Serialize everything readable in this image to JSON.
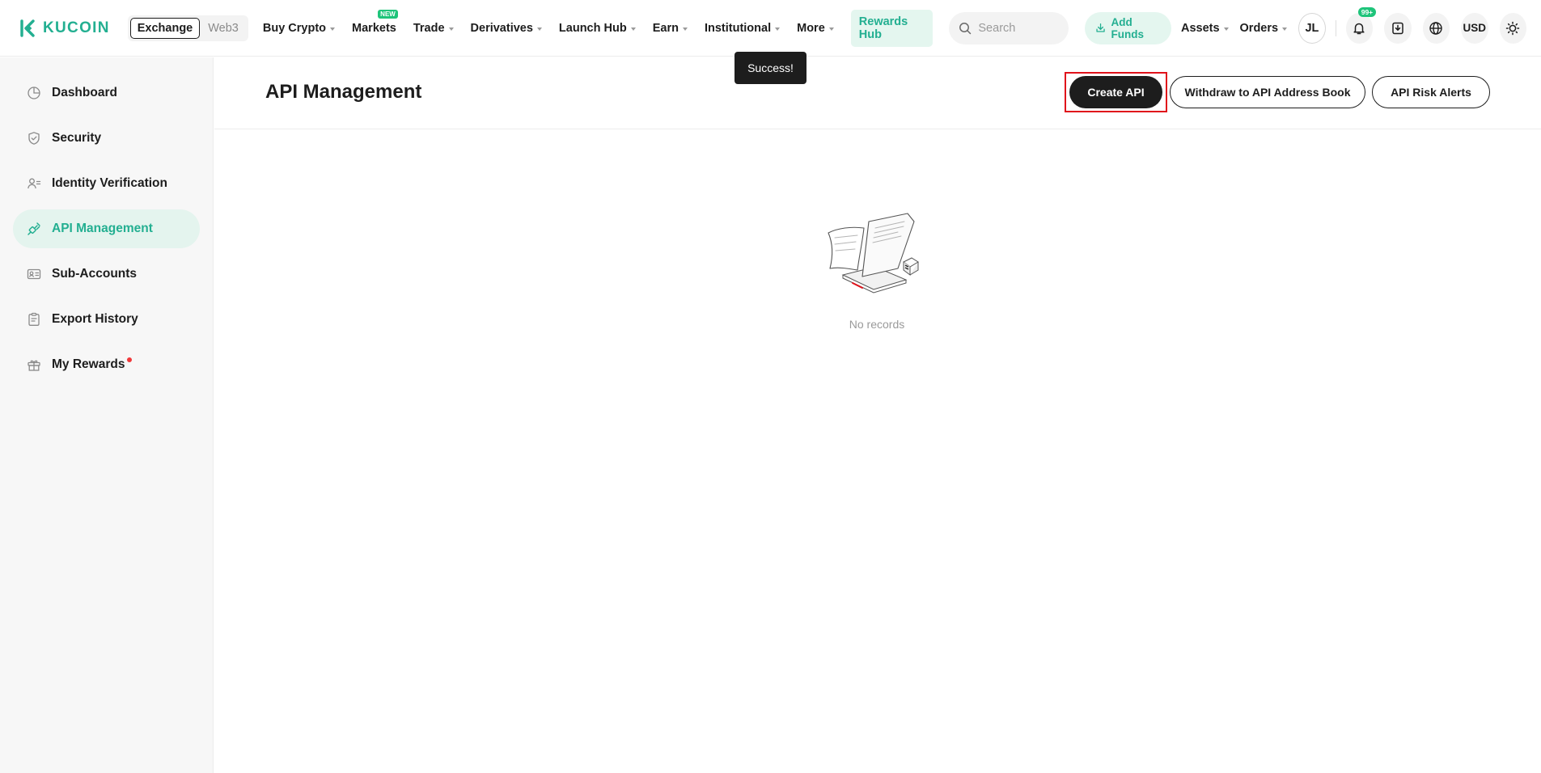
{
  "header": {
    "logo_text": "KUCOIN",
    "switcher": {
      "active": "Exchange",
      "inactive": "Web3"
    },
    "nav": [
      {
        "label": "Buy Crypto",
        "dropdown": true
      },
      {
        "label": "Markets",
        "dropdown": false,
        "badge": "NEW"
      },
      {
        "label": "Trade",
        "dropdown": true
      },
      {
        "label": "Derivatives",
        "dropdown": true
      },
      {
        "label": "Launch Hub",
        "dropdown": true
      },
      {
        "label": "Earn",
        "dropdown": true
      },
      {
        "label": "Institutional",
        "dropdown": true
      },
      {
        "label": "More",
        "dropdown": true
      }
    ],
    "rewards_hub": "Rewards Hub",
    "search_placeholder": "Search",
    "add_funds": "Add Funds",
    "assets": "Assets",
    "orders": "Orders",
    "avatar_initials": "JL",
    "notification_badge": "99+",
    "currency": "USD"
  },
  "toast": "Success!",
  "sidebar": {
    "items": [
      {
        "label": "Dashboard",
        "icon": "dashboard-icon",
        "active": false
      },
      {
        "label": "Security",
        "icon": "shield-icon",
        "active": false
      },
      {
        "label": "Identity Verification",
        "icon": "id-card-icon",
        "active": false
      },
      {
        "label": "API Management",
        "icon": "api-link-icon",
        "active": true
      },
      {
        "label": "Sub-Accounts",
        "icon": "sub-accounts-icon",
        "active": false
      },
      {
        "label": "Export History",
        "icon": "clipboard-icon",
        "active": false
      },
      {
        "label": "My Rewards",
        "icon": "gift-icon",
        "active": false,
        "dot": true
      }
    ]
  },
  "main": {
    "title": "API Management",
    "buttons": {
      "create": "Create API",
      "withdraw": "Withdraw to API Address Book",
      "risk": "API Risk Alerts"
    },
    "empty_text": "No records"
  },
  "colors": {
    "accent": "#23af91",
    "accent_bg": "#e4f6ef",
    "dark": "#1d1d1d",
    "highlight": "#e0121b",
    "badge_green": "#1ec47a",
    "dot_red": "#f0383a"
  }
}
